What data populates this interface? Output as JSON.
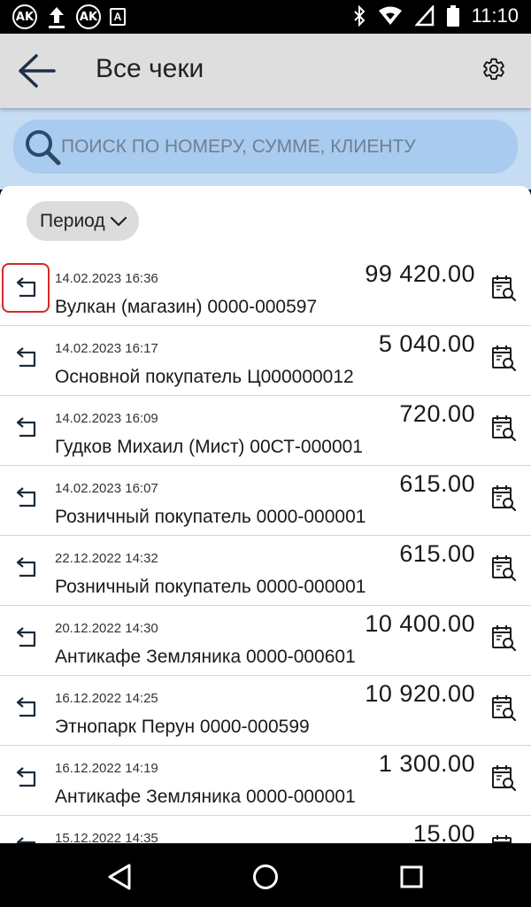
{
  "status_bar": {
    "icons": [
      "ak-app-icon",
      "upload-icon",
      "ak-app-icon",
      "text-a-icon"
    ],
    "right_icons": [
      "bluetooth-icon",
      "wifi-icon",
      "no-sim-icon",
      "battery-icon"
    ],
    "badge_ak": "AK",
    "badge_a": "A",
    "time": "11:10"
  },
  "app_bar": {
    "title": "Все чеки",
    "back_icon": "arrow-left-icon",
    "settings_icon": "gear-icon"
  },
  "search": {
    "placeholder": "ПОИСК ПО НОМЕРУ, СУММЕ, КЛИЕНТУ",
    "value": ""
  },
  "filter": {
    "period_label": "Период"
  },
  "receipts": [
    {
      "date": "14.02.2023 16:36",
      "amount": "99 420.00",
      "client": "Вулкан (магазин) 0000-000597",
      "highlighted": true
    },
    {
      "date": "14.02.2023 16:17",
      "amount": "5 040.00",
      "client": "Основной покупатель Ц000000012"
    },
    {
      "date": "14.02.2023 16:09",
      "amount": "720.00",
      "client": "Гудков Михаил (Мист) 00СТ-000001"
    },
    {
      "date": "14.02.2023 16:07",
      "amount": "615.00",
      "client": "Розничный покупатель 0000-000001"
    },
    {
      "date": "22.12.2022 14:32",
      "amount": "615.00",
      "client": "Розничный покупатель 0000-000001"
    },
    {
      "date": "20.12.2022 14:30",
      "amount": "10 400.00",
      "client": "Антикафе Земляника 0000-000601"
    },
    {
      "date": "16.12.2022 14:25",
      "amount": "10 920.00",
      "client": "Этнопарк Перун 0000-000599"
    },
    {
      "date": "16.12.2022 14:19",
      "amount": "1 300.00",
      "client": "Антикафе Земляника 0000-000001"
    },
    {
      "date": "15.12.2022 14:35",
      "amount": "15.00",
      "client": ""
    }
  ],
  "nav_bar": {
    "icons": [
      "back-triangle-icon",
      "home-circle-icon",
      "recents-square-icon"
    ]
  },
  "colors": {
    "app_bar_bg": "#dedede",
    "search_area_bg": "#c5dcf3",
    "search_box_bg": "#a9cbef",
    "highlight_border": "#d62828"
  }
}
